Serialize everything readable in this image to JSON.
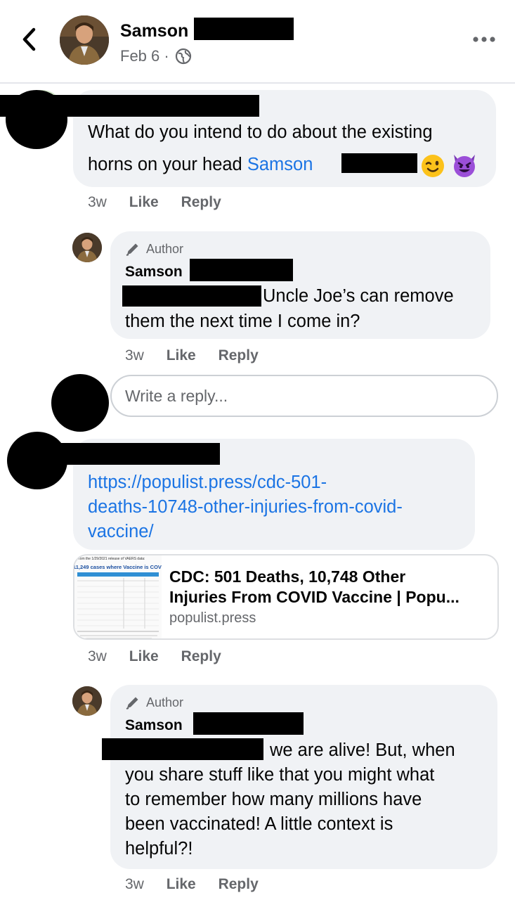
{
  "header": {
    "poster_name": "Samson",
    "date": "Feb 6",
    "separator": "·"
  },
  "comments": [
    {
      "text_line1": "What do you intend to do about the existing",
      "text_line2_prefix": "horns on your head",
      "mention": "Samson",
      "emojis": [
        "winking-face-emoji",
        "smiling-devil-emoji"
      ],
      "time": "3w",
      "like": "Like",
      "reply": "Reply"
    },
    {
      "badge": "Author",
      "name": "Samson",
      "text_line1": "Uncle Joe’s can remove",
      "text_line2": "them the next time I come in?",
      "time": "3w",
      "like": "Like",
      "reply": "Reply"
    },
    {
      "link_line1": "https://populist.press/cdc-501-",
      "link_line2": "deaths-10748-other-injuries-from-covid-",
      "link_line3": "vaccine/",
      "preview": {
        "title_line1": "CDC: 501 Deaths, 10,748 Other",
        "title_line2": "Injuries From COVID Vaccine | Popu...",
        "domain": "populist.press",
        "thumb_caption": "rom the 1/29/2021 release of VAERS data:",
        "thumb_heading": "11,249 cases where Vaccine is COV"
      },
      "time": "3w",
      "like": "Like",
      "reply": "Reply"
    },
    {
      "badge": "Author",
      "name": "Samson",
      "text_line1": "we are alive!  But, when",
      "text_line2": "you share stuff like that you might what",
      "text_line3": "to remember how many millions have",
      "text_line4": "been vaccinated!  A little context is",
      "text_line5": "helpful?!",
      "time": "3w",
      "like": "Like",
      "reply": "Reply"
    }
  ],
  "reply_box": {
    "placeholder": "Write a reply..."
  },
  "icons": {
    "back": "chevron-left-icon",
    "audience": "globe-icon",
    "more": "more-options-icon",
    "author": "pen-icon"
  },
  "colors": {
    "link": "#1b74e4",
    "bubble": "#f0f2f5",
    "meta": "#65676b"
  }
}
